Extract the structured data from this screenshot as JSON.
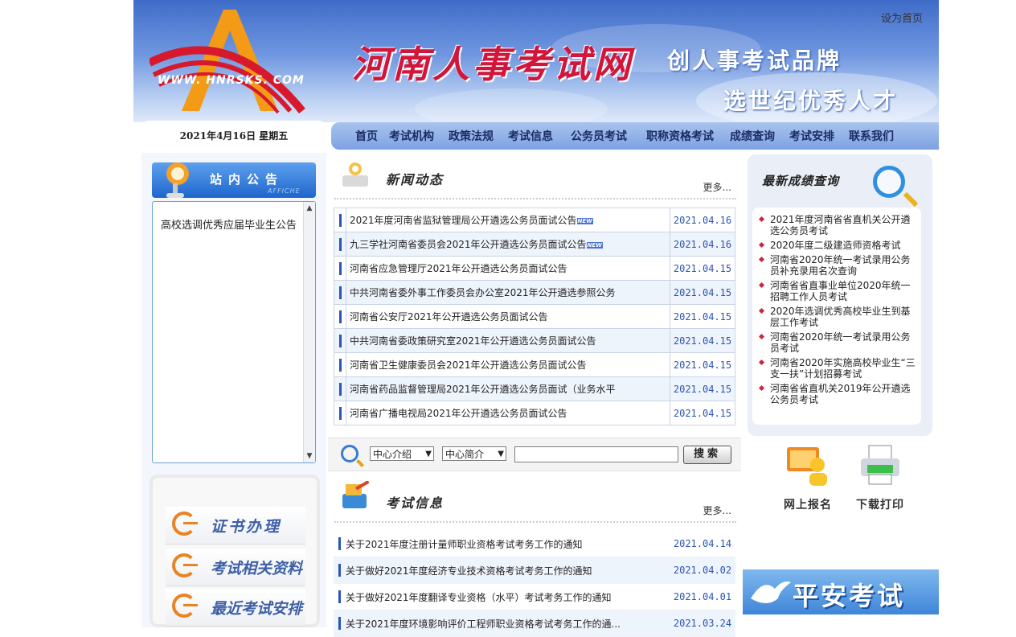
{
  "header": {
    "logo_text": "WWW. HNRSKS. COM",
    "site_title": "河南人事考试网",
    "slogan_1": "创人事考试品牌",
    "slogan_2": "选世纪优秀人才",
    "set_home": "设为首页"
  },
  "date_line": "2021年4月16日 星期五",
  "nav": [
    "首页",
    "考试机构",
    "政策法规",
    "考试信息",
    "公务员考试",
    "职称资格考试",
    "成绩查询",
    "考试安排",
    "联系我们"
  ],
  "affiche": {
    "title": "站内公告",
    "subtitle": "AFFICHE",
    "content": "高校选调优秀应届毕业生公告"
  },
  "quick_links": [
    "证书办理",
    "考试相关资料",
    "最近考试安排"
  ],
  "news": {
    "title": "新闻动态",
    "more": "更多...",
    "new_badge": "NEW",
    "items": [
      {
        "title": "2021年度河南省监狱管理局公开遴选公务员面试公告",
        "date": "2021.04.16",
        "new": true
      },
      {
        "title": "九三学社河南省委员会2021年公开遴选公务员面试公告",
        "date": "2021.04.16",
        "new": true
      },
      {
        "title": "河南省应急管理厅2021年公开遴选公务员面试公告",
        "date": "2021.04.15",
        "new": false
      },
      {
        "title": "中共河南省委外事工作委员会办公室2021年公开遴选参照公务",
        "date": "2021.04.15",
        "new": false
      },
      {
        "title": "河南省公安厅2021年公开遴选公务员面试公告",
        "date": "2021.04.15",
        "new": false
      },
      {
        "title": "中共河南省委政策研究室2021年公开遴选公务员面试公告",
        "date": "2021.04.15",
        "new": false
      },
      {
        "title": "河南省卫生健康委员会2021年公开遴选公务员面试公告",
        "date": "2021.04.15",
        "new": false
      },
      {
        "title": "河南省药品监督管理局2021年公开遴选公务员面试（业务水平",
        "date": "2021.04.15",
        "new": false
      },
      {
        "title": "河南省广播电视局2021年公开遴选公务员面试公告",
        "date": "2021.04.15",
        "new": false
      }
    ]
  },
  "search": {
    "select_1": "中心介绍",
    "select_2": "中心简介",
    "input_value": "",
    "button": "搜索"
  },
  "exam_info": {
    "title": "考试信息",
    "more": "更多...",
    "items": [
      {
        "title": "关于2021年度注册计量师职业资格考试考务工作的通知",
        "date": "2021.04.14"
      },
      {
        "title": "关于做好2021年度经济专业技术资格考试考务工作的通知",
        "date": "2021.04.02"
      },
      {
        "title": "关于做好2021年度翻译专业资格（水平）考试考务工作的通知",
        "date": "2021.04.01"
      },
      {
        "title": "关于2021年度环境影响评价工程师职业资格考试考务工作的通...",
        "date": "2021.03.24"
      }
    ]
  },
  "scores": {
    "title": "最新成绩查询",
    "items": [
      "2021年度河南省省直机关公开遴选公务员考试",
      "2020年度二级建造师资格考试",
      "河南省2020年统一考试录用公务员补充录用名次查询",
      "河南省省直事业单位2020年统一招聘工作人员考试",
      "2020年选调优秀高校毕业生到基层工作考试",
      "河南省2020年统一考试录用公务员考试",
      "河南省2020年实施高校毕业生“三支一扶”计划招募考试",
      "河南省省直机关2019年公开遴选公务员考试"
    ]
  },
  "services": [
    {
      "label": "网上报名",
      "icon": "online-signup-icon"
    },
    {
      "label": "下载打印",
      "icon": "printer-icon"
    }
  ],
  "banner": "平安考试",
  "colors": {
    "brand_blue": "#2c54b4",
    "title_red": "#d2153a",
    "accent_orange": "#e88424"
  }
}
